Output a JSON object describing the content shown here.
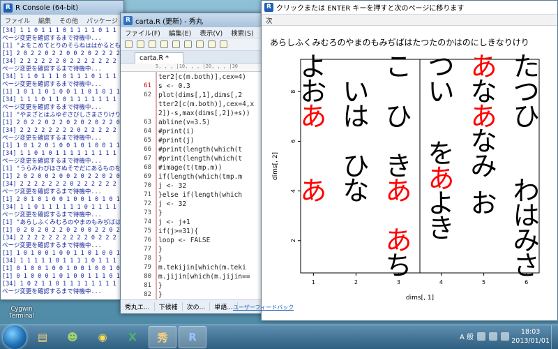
{
  "console": {
    "title": "R Console (64-bit)",
    "menu": [
      "ファイル",
      "編集",
      "その他",
      "パッケージ"
    ],
    "toolbar": [
      "→",
      "■"
    ],
    "lines": [
      "[34] 1 1 0 1 1 1 0 1 1 1 1 0 1 1 1",
      "ページ変更を確認するまで待機中...",
      "[1] \"よをこめてとりのそらねははかるともよ",
      "[1] 2 0 2 2 0 2 2 0 0 2 0 2 2 2 2",
      "[34] 2 2 2 2 2 2 0 2 2 2 2 2 2 2 2",
      "ページ変更を確認するまで待機中...",
      "[34] 1 1 0 1 1 1 0 1 1 1 0 1 1 1 1",
      "ページ変更を確認するまで待機中...",
      "[1] 1 0 1 1 0 1 0 0 1 1 0 1 0 1 1",
      "[34] 1 1 1 0 1 1 0 1 1 1 1 1 1 1 1",
      "ページ変更を確認するまで待機中...",
      "[1] \"やまざとはふゆぞさびしさまさりけり",
      "[1] 2 0 2 2 0 2 2 0 2 0 2 0 2 2 0",
      "[34] 2 2 2 2 2 2 2 2 0 2 2 2 2 2 2",
      "ページ変更を確認するまで待機中...",
      "[1] 1 0 1 2 0 1 0 0 1 0 1 0 0 1 1",
      "[34] 1 1 0 1 0 1 1 1 1 1 1 1 1 1 1",
      "ページ変更を確認するまで待機中...",
      "[1] \"うらみわびほさぬそでだにあるものを",
      "[1] 2 0 2 0 0 2 0 0 2 0 2 2 0 2 0",
      "[34] 2 2 2 2 2 2 2 0 2 2 2 2 2 2 2",
      "ページ変更を確認するまで待機中...",
      "[1] 2 0 1 0 1 0 0 1 0 0 1 0 1 0 1",
      "[34] 1 1 0 1 1 1 1 1 1 0 1 1 1 1 1",
      "ページ変更を確認するまで待機中...",
      "[1] \"あらしふくみむろのやまのもみぢばは",
      "[1] 0 2 0 2 0 2 2 0 2 0 0 2 2 0 2",
      "[34] 2 2 2 2 2 2 2 2 2 2 0 2 2 2 2",
      "ページ変更を確認するまで待機中...",
      "[1] 1 0 1 0 0 1 0 0 1 1 0 1 0 0 1",
      "[34] 1 1 1 1 1 0 1 1 1 1 0 1 1 1 1",
      "[1] 0 1 0 0 1 0 0 1 0 0 1 0 0 1 0",
      "[1] 0 1 0 0 0 1 0 1 0 0 1 1 1 0 1",
      "[34] 1 0 2 1 1 0 1 1 1 1 1 1 1 1 1",
      "ページ変更を確認するまで待機中..."
    ]
  },
  "editor": {
    "title": "carta.R (更新) - 秀丸",
    "menu": [
      "ファイル(F)",
      "編集(E)",
      "表示(V)",
      "検索(S)",
      "ウィンドウ"
    ],
    "tab": "carta.R *",
    "ruler": "5, , , |10, , , |20, , , |30",
    "lines": [
      {
        "n": "",
        "t": "ter2[c(m.both)],cex=4)"
      },
      {
        "n": "61",
        "t": "  s <- 0.3"
      },
      {
        "n": "62",
        "t": "  plot(dims[,1],dims[,2"
      },
      {
        "n": "",
        "t": "tter2[c(m.both)],cex=4,x"
      },
      {
        "n": "",
        "t": "2])-s,max(dims[,2])+s))"
      },
      {
        "n": "63",
        "t": "  abline(v=3.5)"
      },
      {
        "n": "64",
        "t": "  #print(i)"
      },
      {
        "n": "65",
        "t": "  #print(j)"
      },
      {
        "n": "66",
        "t": "  #print(length(which(t"
      },
      {
        "n": "67",
        "t": "  #print(length(which(t"
      },
      {
        "n": "68",
        "t": "  #image(t(tmp.m))"
      },
      {
        "n": "69",
        "t": "  if(length(which(tmp.m"
      },
      {
        "n": "70",
        "t": "    j <- 32"
      },
      {
        "n": "71",
        "t": "  }else if(length(which"
      },
      {
        "n": "72",
        "t": "    j <- 32"
      },
      {
        "n": "73",
        "t": "  }"
      },
      {
        "n": "74",
        "t": "  j <- j+1"
      },
      {
        "n": "75",
        "t": "  if(j>=31){"
      },
      {
        "n": "76",
        "t": "    loop <- FALSE"
      },
      {
        "n": "77",
        "t": "  }"
      },
      {
        "n": "78",
        "t": "}"
      },
      {
        "n": "79",
        "t": "m.tekijin[which(m.teki"
      },
      {
        "n": "80",
        "t": "m.jijin[which(m.jijin=="
      },
      {
        "n": "81",
        "t": "}"
      },
      {
        "n": "82",
        "t": "}"
      },
      {
        "n": "83",
        "t": "[EOF]"
      }
    ],
    "current_line": "61",
    "status": [
      "秀丸エ...",
      "下候補",
      "次の...",
      "単語..."
    ],
    "feedback": "ユーザーフィードバック"
  },
  "graphics": {
    "title": "クリックまたは ENTER キーを押すと次のページに移ります",
    "menu": [
      "次"
    ],
    "poem": "あらしふくみむろのやまのもみぢばはたつたのかはのにしきなりけり"
  },
  "chart_data": {
    "type": "scatter",
    "title": "",
    "xlabel": "dims[, 1]",
    "ylabel": "dims[, 2]",
    "xlim": [
      0.7,
      6.3
    ],
    "ylim": [
      0.7,
      9.3
    ],
    "x_ticks": [
      1,
      2,
      3,
      4,
      5,
      6
    ],
    "y_ticks": [
      2,
      4,
      6,
      8
    ],
    "vline": 3.5,
    "colors": {
      "highlight": "#ff0000",
      "normal": "#000000"
    },
    "points": [
      {
        "x": 6,
        "y": 9,
        "label": "た",
        "hl": false
      },
      {
        "x": 6,
        "y": 8,
        "label": "つ",
        "hl": false
      },
      {
        "x": 6,
        "y": 7,
        "label": "ひ",
        "hl": false
      },
      {
        "x": 6,
        "y": 4,
        "label": "わ",
        "hl": false
      },
      {
        "x": 6,
        "y": 3,
        "label": "は",
        "hl": false
      },
      {
        "x": 6,
        "y": 2,
        "label": "み",
        "hl": false
      },
      {
        "x": 6,
        "y": 1,
        "label": "さ",
        "hl": false
      },
      {
        "x": 5,
        "y": 9,
        "label": "あ",
        "hl": true
      },
      {
        "x": 5,
        "y": 8,
        "label": "な",
        "hl": false
      },
      {
        "x": 5,
        "y": 7,
        "label": "あ",
        "hl": true
      },
      {
        "x": 5,
        "y": 6,
        "label": "な",
        "hl": false
      },
      {
        "x": 5,
        "y": 3.5,
        "label": "お",
        "hl": false
      },
      {
        "x": 4,
        "y": 9,
        "label": "つ",
        "hl": false
      },
      {
        "x": 4,
        "y": 8,
        "label": "い",
        "hl": false
      },
      {
        "x": 4,
        "y": 5.5,
        "label": "を",
        "hl": false
      },
      {
        "x": 4,
        "y": 4.5,
        "label": "あ",
        "hl": true
      },
      {
        "x": 4,
        "y": 3.5,
        "label": "よ",
        "hl": false
      },
      {
        "x": 4,
        "y": 2.5,
        "label": "き",
        "hl": false
      },
      {
        "x": 5,
        "y": 5,
        "label": "み",
        "hl": false
      },
      {
        "x": 3,
        "y": 9,
        "label": "こ",
        "hl": false
      },
      {
        "x": 3,
        "y": 7,
        "label": "ひ",
        "hl": false
      },
      {
        "x": 3,
        "y": 5,
        "label": "き",
        "hl": false
      },
      {
        "x": 3,
        "y": 4,
        "label": "あ",
        "hl": true
      },
      {
        "x": 3,
        "y": 2,
        "label": "あ",
        "hl": true
      },
      {
        "x": 3,
        "y": 1,
        "label": "ち",
        "hl": false
      },
      {
        "x": 2,
        "y": 8,
        "label": "い",
        "hl": false
      },
      {
        "x": 2,
        "y": 7,
        "label": "は",
        "hl": false
      },
      {
        "x": 2,
        "y": 5,
        "label": "ひ",
        "hl": false
      },
      {
        "x": 2,
        "y": 4,
        "label": "な",
        "hl": false
      },
      {
        "x": 1,
        "y": 9,
        "label": "よ",
        "hl": false
      },
      {
        "x": 1,
        "y": 8,
        "label": "お",
        "hl": false
      },
      {
        "x": 1,
        "y": 7,
        "label": "あ",
        "hl": true
      },
      {
        "x": 1,
        "y": 4,
        "label": "あ",
        "hl": true
      }
    ]
  },
  "desktop": {
    "cygwin_label": "Cygwin Terminal"
  },
  "taskbar": {
    "items": [
      {
        "name": "explorer",
        "glyph": "▤",
        "color": "#f3d27a"
      },
      {
        "name": "app-green",
        "glyph": "☻",
        "color": "#9fd36b"
      },
      {
        "name": "chrome",
        "glyph": "◉",
        "color": "#ffdd55"
      },
      {
        "name": "excel",
        "glyph": "X",
        "color": "#4fb06a"
      },
      {
        "name": "hidemaru",
        "glyph": "秀",
        "color": "#ffd27a"
      },
      {
        "name": "r",
        "glyph": "R",
        "color": "#9bc3ff"
      }
    ],
    "ime": "A 般",
    "time": "18:03",
    "date": "2013/01/01"
  }
}
